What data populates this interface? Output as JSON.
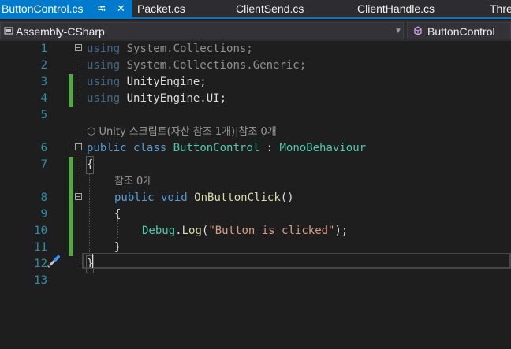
{
  "tabs": [
    {
      "label": "ButtonControl.cs",
      "active": true,
      "pinned": true
    },
    {
      "label": "Packet.cs"
    },
    {
      "label": "ClientSend.cs"
    },
    {
      "label": "ClientHandle.cs"
    },
    {
      "label": "Thre"
    }
  ],
  "nav": {
    "project": "Assembly-CSharp",
    "class": "ButtonControl"
  },
  "lines": {
    "l1": {
      "n": "1",
      "kw": "using",
      "rest": " System.Collections;"
    },
    "l2": {
      "n": "2",
      "kw": "using",
      "rest": " System.Collections.Generic;"
    },
    "l3": {
      "n": "3",
      "kw": "using",
      "rest": " UnityEngine;"
    },
    "l4": {
      "n": "4",
      "kw": "using",
      "rest": " UnityEngine.UI;"
    },
    "l5": {
      "n": "5"
    },
    "lens1": {
      "text": "Unity 스크립트(자산 참조 1개)|참조 0개"
    },
    "l6": {
      "n": "6",
      "kw1": "public",
      "kw2": "class",
      "name": "ButtonControl",
      "sep": " : ",
      "base": "MonoBehaviour"
    },
    "l7": {
      "n": "7",
      "text": "{"
    },
    "lens2": {
      "text": "참조 0개"
    },
    "l8": {
      "n": "8",
      "kw1": "public",
      "kw2": "void",
      "name": "OnButtonClick",
      "args": "()"
    },
    "l9": {
      "n": "9",
      "text": "{"
    },
    "l10": {
      "n": "10",
      "type": "Debug",
      "dot": ".",
      "method": "Log",
      "open": "(",
      "str": "\"Button is clicked\"",
      "close": ");"
    },
    "l11": {
      "n": "11",
      "text": "}"
    },
    "l12": {
      "n": "12",
      "text": "}"
    },
    "l13": {
      "n": "13"
    }
  },
  "colors": {
    "accent": "#007acc",
    "keyword": "#569cd6",
    "type": "#4ec9b0",
    "method": "#dcdcaa",
    "string": "#d69d85",
    "line_number": "#2b91af",
    "change_marker": "#57a64a"
  }
}
